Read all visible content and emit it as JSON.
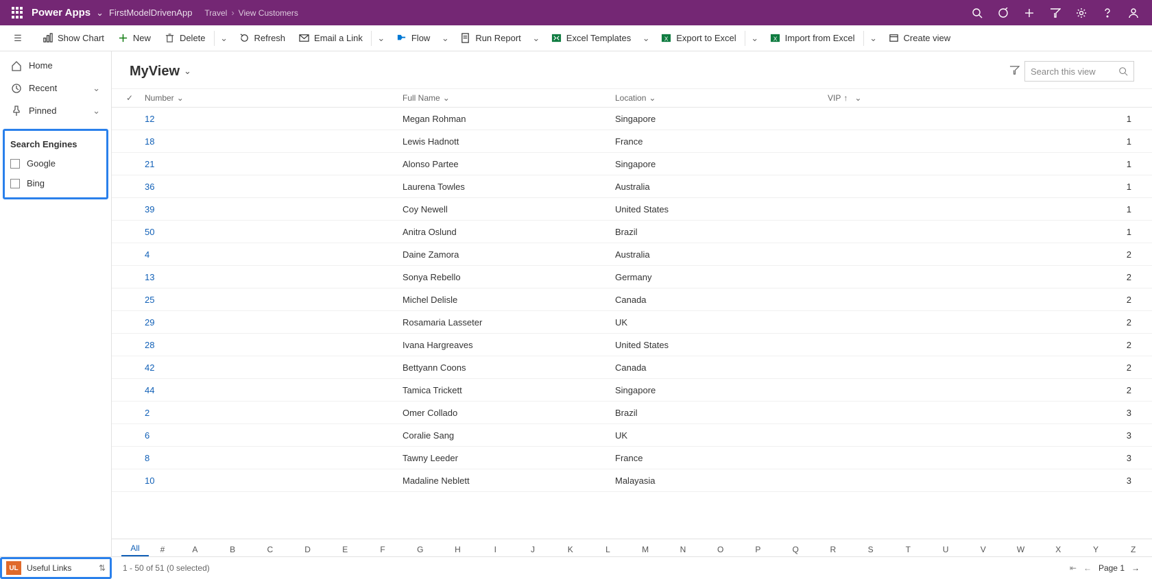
{
  "topbar": {
    "brand": "Power Apps",
    "app": "FirstModelDrivenApp",
    "crumb1": "Travel",
    "crumb2": "View Customers"
  },
  "cmds": {
    "show_chart": "Show Chart",
    "new": "New",
    "delete": "Delete",
    "refresh": "Refresh",
    "email": "Email a Link",
    "flow": "Flow",
    "run_report": "Run Report",
    "excel_templates": "Excel Templates",
    "export": "Export to Excel",
    "import": "Import from Excel",
    "create_view": "Create view"
  },
  "sidebar": {
    "home": "Home",
    "recent": "Recent",
    "pinned": "Pinned",
    "group_title": "Search Engines",
    "google": "Google",
    "bing": "Bing"
  },
  "view": {
    "name": "MyView",
    "search_placeholder": "Search this view"
  },
  "columns": {
    "number": "Number",
    "fullname": "Full Name",
    "location": "Location",
    "vip": "VIP"
  },
  "rows": [
    {
      "num": "12",
      "name": "Megan Rohman",
      "loc": "Singapore",
      "vip": "1"
    },
    {
      "num": "18",
      "name": "Lewis Hadnott",
      "loc": "France",
      "vip": "1"
    },
    {
      "num": "21",
      "name": "Alonso Partee",
      "loc": "Singapore",
      "vip": "1"
    },
    {
      "num": "36",
      "name": "Laurena Towles",
      "loc": "Australia",
      "vip": "1"
    },
    {
      "num": "39",
      "name": "Coy Newell",
      "loc": "United States",
      "vip": "1"
    },
    {
      "num": "50",
      "name": "Anitra Oslund",
      "loc": "Brazil",
      "vip": "1"
    },
    {
      "num": "4",
      "name": "Daine Zamora",
      "loc": "Australia",
      "vip": "2"
    },
    {
      "num": "13",
      "name": "Sonya Rebello",
      "loc": "Germany",
      "vip": "2"
    },
    {
      "num": "25",
      "name": "Michel Delisle",
      "loc": "Canada",
      "vip": "2"
    },
    {
      "num": "29",
      "name": "Rosamaria Lasseter",
      "loc": "UK",
      "vip": "2"
    },
    {
      "num": "28",
      "name": "Ivana Hargreaves",
      "loc": "United States",
      "vip": "2"
    },
    {
      "num": "42",
      "name": "Bettyann Coons",
      "loc": "Canada",
      "vip": "2"
    },
    {
      "num": "44",
      "name": "Tamica Trickett",
      "loc": "Singapore",
      "vip": "2"
    },
    {
      "num": "2",
      "name": "Omer Collado",
      "loc": "Brazil",
      "vip": "3"
    },
    {
      "num": "6",
      "name": "Coralie Sang",
      "loc": "UK",
      "vip": "3"
    },
    {
      "num": "8",
      "name": "Tawny Leeder",
      "loc": "France",
      "vip": "3"
    },
    {
      "num": "10",
      "name": "Madaline Neblett",
      "loc": "Malayasia",
      "vip": "3"
    }
  ],
  "alpha": {
    "all": "All",
    "hash": "#",
    "letters": [
      "A",
      "B",
      "C",
      "D",
      "E",
      "F",
      "G",
      "H",
      "I",
      "J",
      "K",
      "L",
      "M",
      "N",
      "O",
      "P",
      "Q",
      "R",
      "S",
      "T",
      "U",
      "V",
      "W",
      "X",
      "Y",
      "Z"
    ]
  },
  "footer": {
    "area_abbr": "UL",
    "area_name": "Useful Links",
    "status": "1 - 50 of 51 (0 selected)",
    "page": "Page 1"
  }
}
